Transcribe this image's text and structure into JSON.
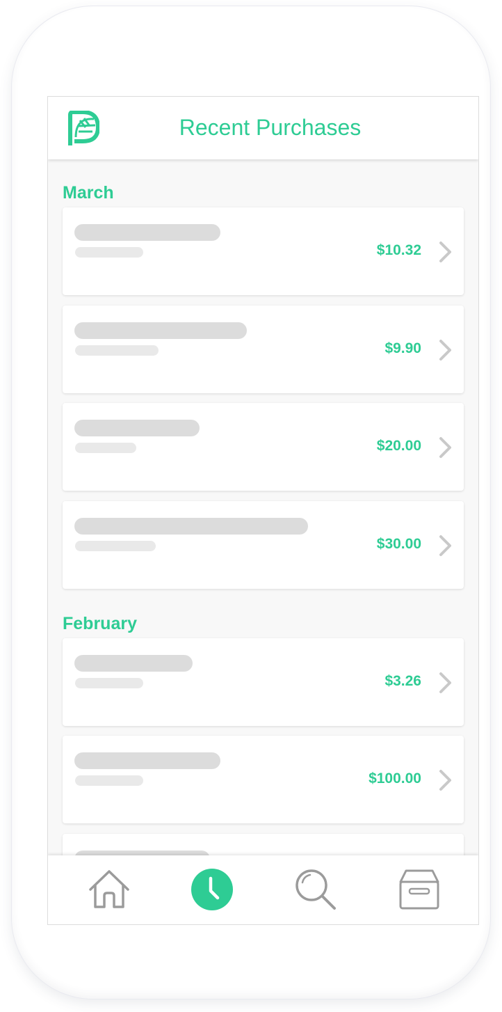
{
  "app": {
    "title": "Recent Purchases",
    "logo_icon": "leaf-logo-icon",
    "accent_color": "#2ecc94"
  },
  "sections": [
    {
      "label": "March",
      "items": [
        {
          "price": "$10.32"
        },
        {
          "price": "$9.90"
        },
        {
          "price": "$20.00"
        },
        {
          "price": "$30.00"
        }
      ]
    },
    {
      "label": "February",
      "items": [
        {
          "price": "$3.26"
        },
        {
          "price": "$100.00"
        }
      ]
    }
  ],
  "tabbar": {
    "tabs": [
      {
        "icon": "home-icon",
        "active": false
      },
      {
        "icon": "clock-icon",
        "active": true
      },
      {
        "icon": "search-icon",
        "active": false
      },
      {
        "icon": "archive-box-icon",
        "active": false
      }
    ]
  }
}
